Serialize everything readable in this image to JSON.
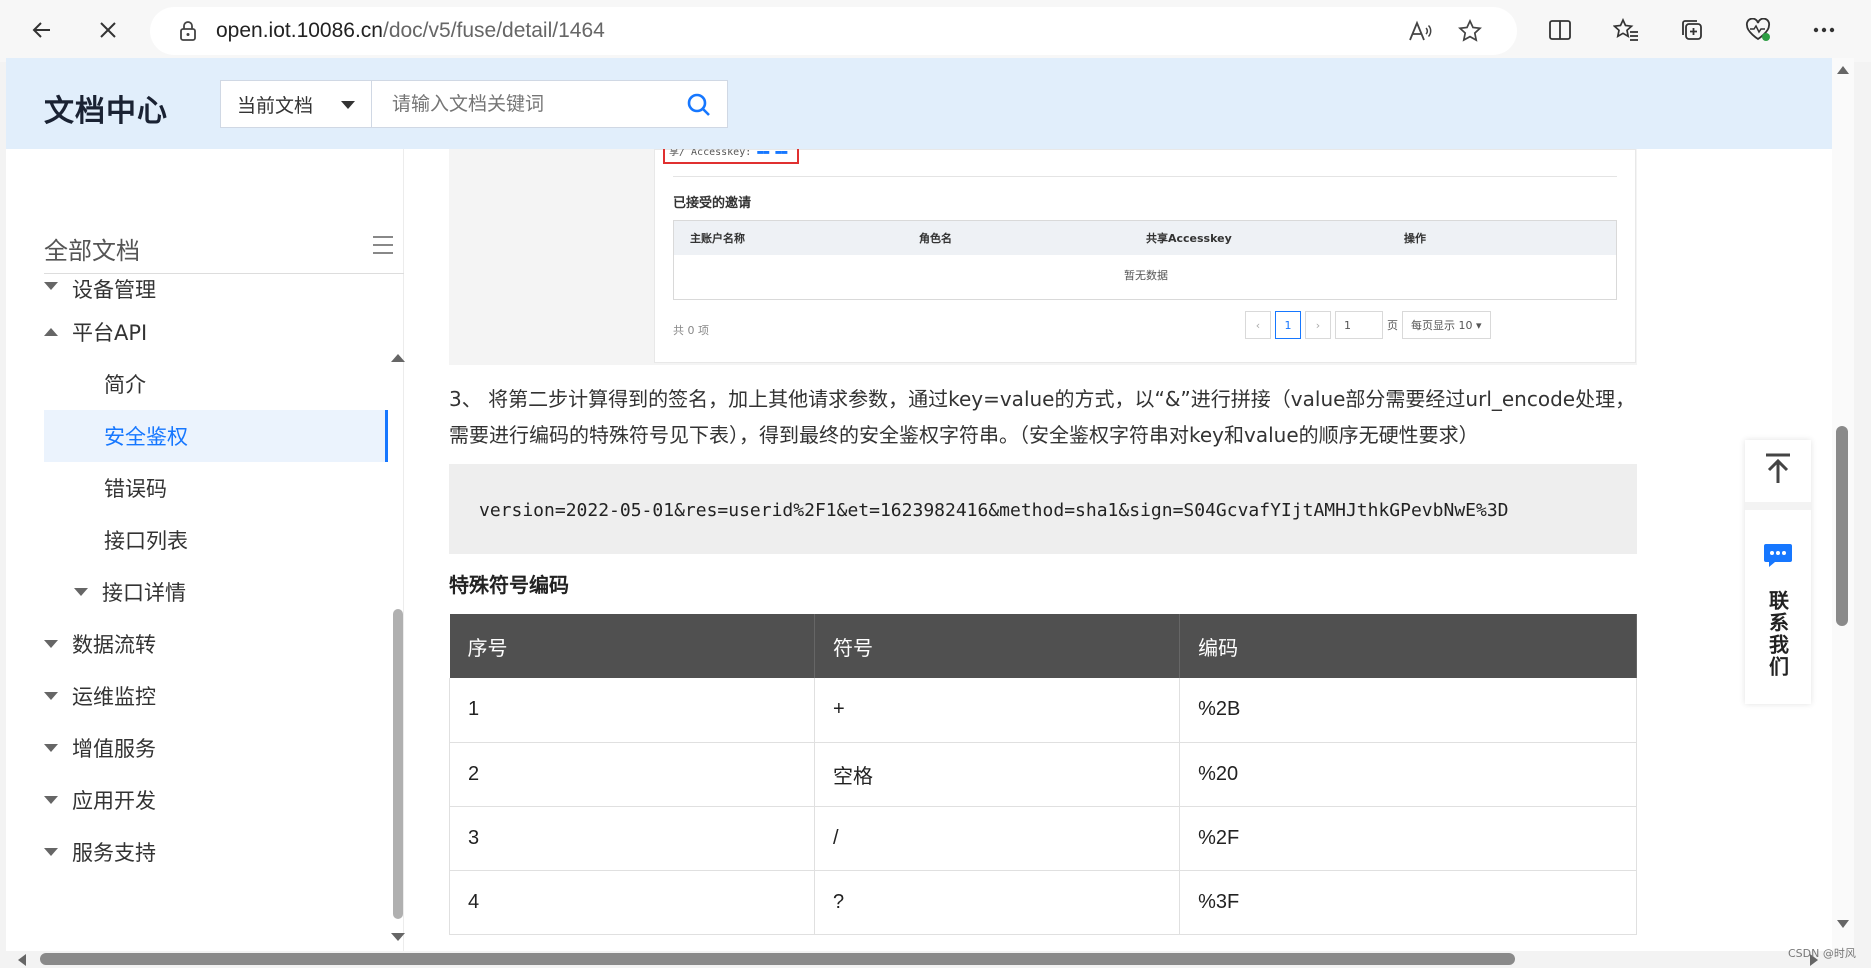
{
  "browser": {
    "url_host": "open.iot.10086.cn",
    "url_path": "/doc/v5/fuse/detail/1464"
  },
  "header": {
    "logo": "文档中心",
    "search_scope": "当前文档",
    "search_placeholder": "请输入文档关键词"
  },
  "sidebar": {
    "title": "全部文档",
    "items": [
      {
        "label": "设备管理"
      },
      {
        "label": "平台API"
      },
      {
        "label": "简介"
      },
      {
        "label": "安全鉴权"
      },
      {
        "label": "错误码"
      },
      {
        "label": "接口列表"
      },
      {
        "label": "接口详情"
      },
      {
        "label": "数据流转"
      },
      {
        "label": "运维监控"
      },
      {
        "label": "增值服务"
      },
      {
        "label": "应用开发"
      },
      {
        "label": "服务支持"
      }
    ]
  },
  "screenshot": {
    "accesskey_snippet": "享/ Accesskey:",
    "heading": "已接受的邀请",
    "columns": [
      "主账户名称",
      "角色名",
      "共享Accesskey",
      "操作"
    ],
    "empty_text": "暂无数据",
    "total": "共 0 项",
    "page_current": "1",
    "page_input": "1",
    "page_unit": "页",
    "page_size": "每页显示 10"
  },
  "content": {
    "paragraph": "3、 将第二步计算得到的签名，加上其他请求参数，通过key=value的方式，以“&”进行拼接（value部分需要经过url_encode处理，需要进行编码的特殊符号见下表），得到最终的安全鉴权字符串。（安全鉴权字符串对key和value的顺序无硬性要求）",
    "code": "version=2022-05-01&res=userid%2F1&et=1623982416&method=sha1&sign=S04GcvafYIjtAMHJthkGPevbNwE%3D",
    "table_title": "特殊符号编码",
    "table_headers": [
      "序号",
      "符号",
      "编码"
    ],
    "table_rows": [
      [
        "1",
        "+",
        "%2B"
      ],
      [
        "2",
        "空格",
        "%20"
      ],
      [
        "3",
        "/",
        "%2F"
      ],
      [
        "4",
        "?",
        "%3F"
      ]
    ]
  },
  "float_panel": {
    "contact_label": "联系我们"
  },
  "watermark": "CSDN @时风"
}
